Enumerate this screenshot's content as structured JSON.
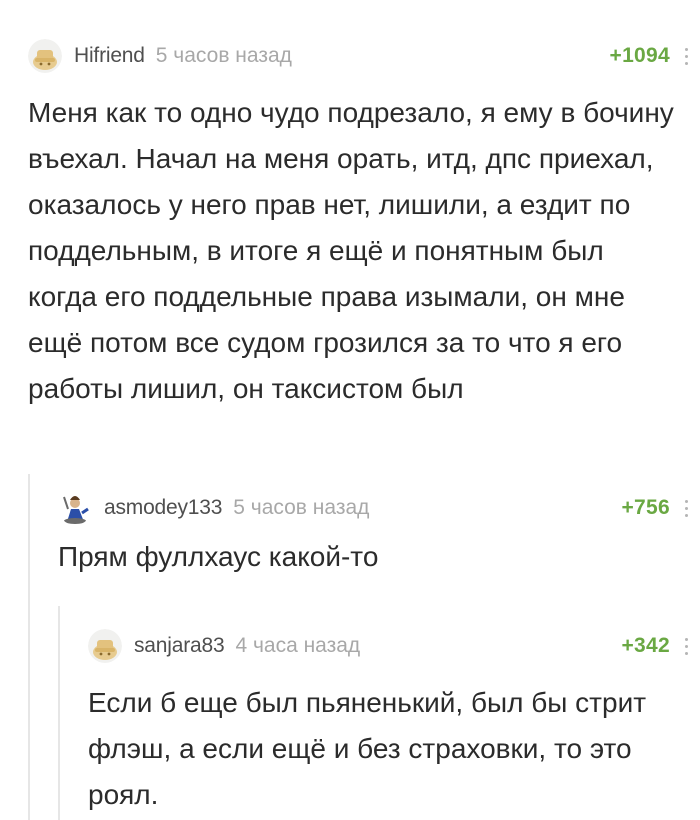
{
  "comments": [
    {
      "username": "Hifriend",
      "time": "5 часов назад",
      "rating": "+1094",
      "avatar_icon": "hat-avatar-icon",
      "text": "Меня как то одно чудо подрезало, я ему в бочину въехал. Начал на меня орать, итд, дпс приехал, оказалось у него прав нет, лишили, а ездит по поддельным, в итоге я ещё и понятным был когда его поддельные права изымали, он мне ещё потом все судом грозился за то что я его работы лишил, он таксистом был"
    },
    {
      "username": "asmodey133",
      "time": "5 часов назад",
      "rating": "+756",
      "avatar_icon": "figure-avatar-icon",
      "text": "Прям фуллхаус какой-то"
    },
    {
      "username": "sanjara83",
      "time": "4 часа назад",
      "rating": "+342",
      "avatar_icon": "hat-avatar-icon",
      "text": "Если б еще был пьяненький, был бы стрит флэш, а если ещё и без страховки, то это роял."
    }
  ],
  "colors": {
    "rating": "#6aa843",
    "username": "#4f4f4f",
    "time": "#a8a8a8",
    "thread_line": "#e6e6e6"
  }
}
